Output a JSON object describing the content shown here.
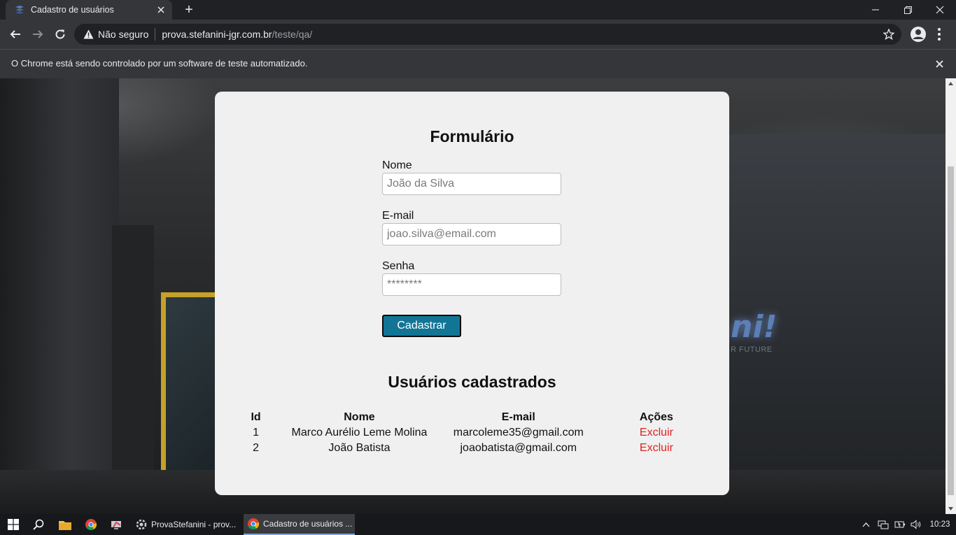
{
  "browser": {
    "tab_title": "Cadastro de usuários",
    "new_tab_label": "+",
    "security_label": "Não seguro",
    "url_host": "prova.stefanini-jgr.com.br",
    "url_path": "/teste/qa/",
    "infobar_text": "O Chrome está sendo controlado por um software de teste automatizado."
  },
  "form": {
    "title": "Formulário",
    "name_label": "Nome",
    "name_placeholder": "João da Silva",
    "email_label": "E-mail",
    "email_placeholder": "joao.silva@email.com",
    "password_label": "Senha",
    "password_placeholder": "********",
    "submit_label": "Cadastrar"
  },
  "users": {
    "title": "Usuários cadastrados",
    "headers": [
      "Id",
      "Nome",
      "E-mail",
      "Ações"
    ],
    "rows": [
      {
        "id": "1",
        "name": "Marco Aurélio Leme Molina",
        "email": "marcoleme35@gmail.com",
        "action": "Excluir"
      },
      {
        "id": "2",
        "name": "João Batista",
        "email": "joaobatista@gmail.com",
        "action": "Excluir"
      }
    ]
  },
  "background": {
    "logo_text": "ni!",
    "logo_subtext": "R FUTURE"
  },
  "taskbar": {
    "apps": [
      {
        "label": "ProvaStefanini - prov..."
      },
      {
        "label": "Cadastro de usuários ..."
      }
    ],
    "clock": "10:23"
  },
  "colors": {
    "button_bg": "#137595",
    "delete_link": "#e02020",
    "card_bg": "#f0f0f0"
  }
}
